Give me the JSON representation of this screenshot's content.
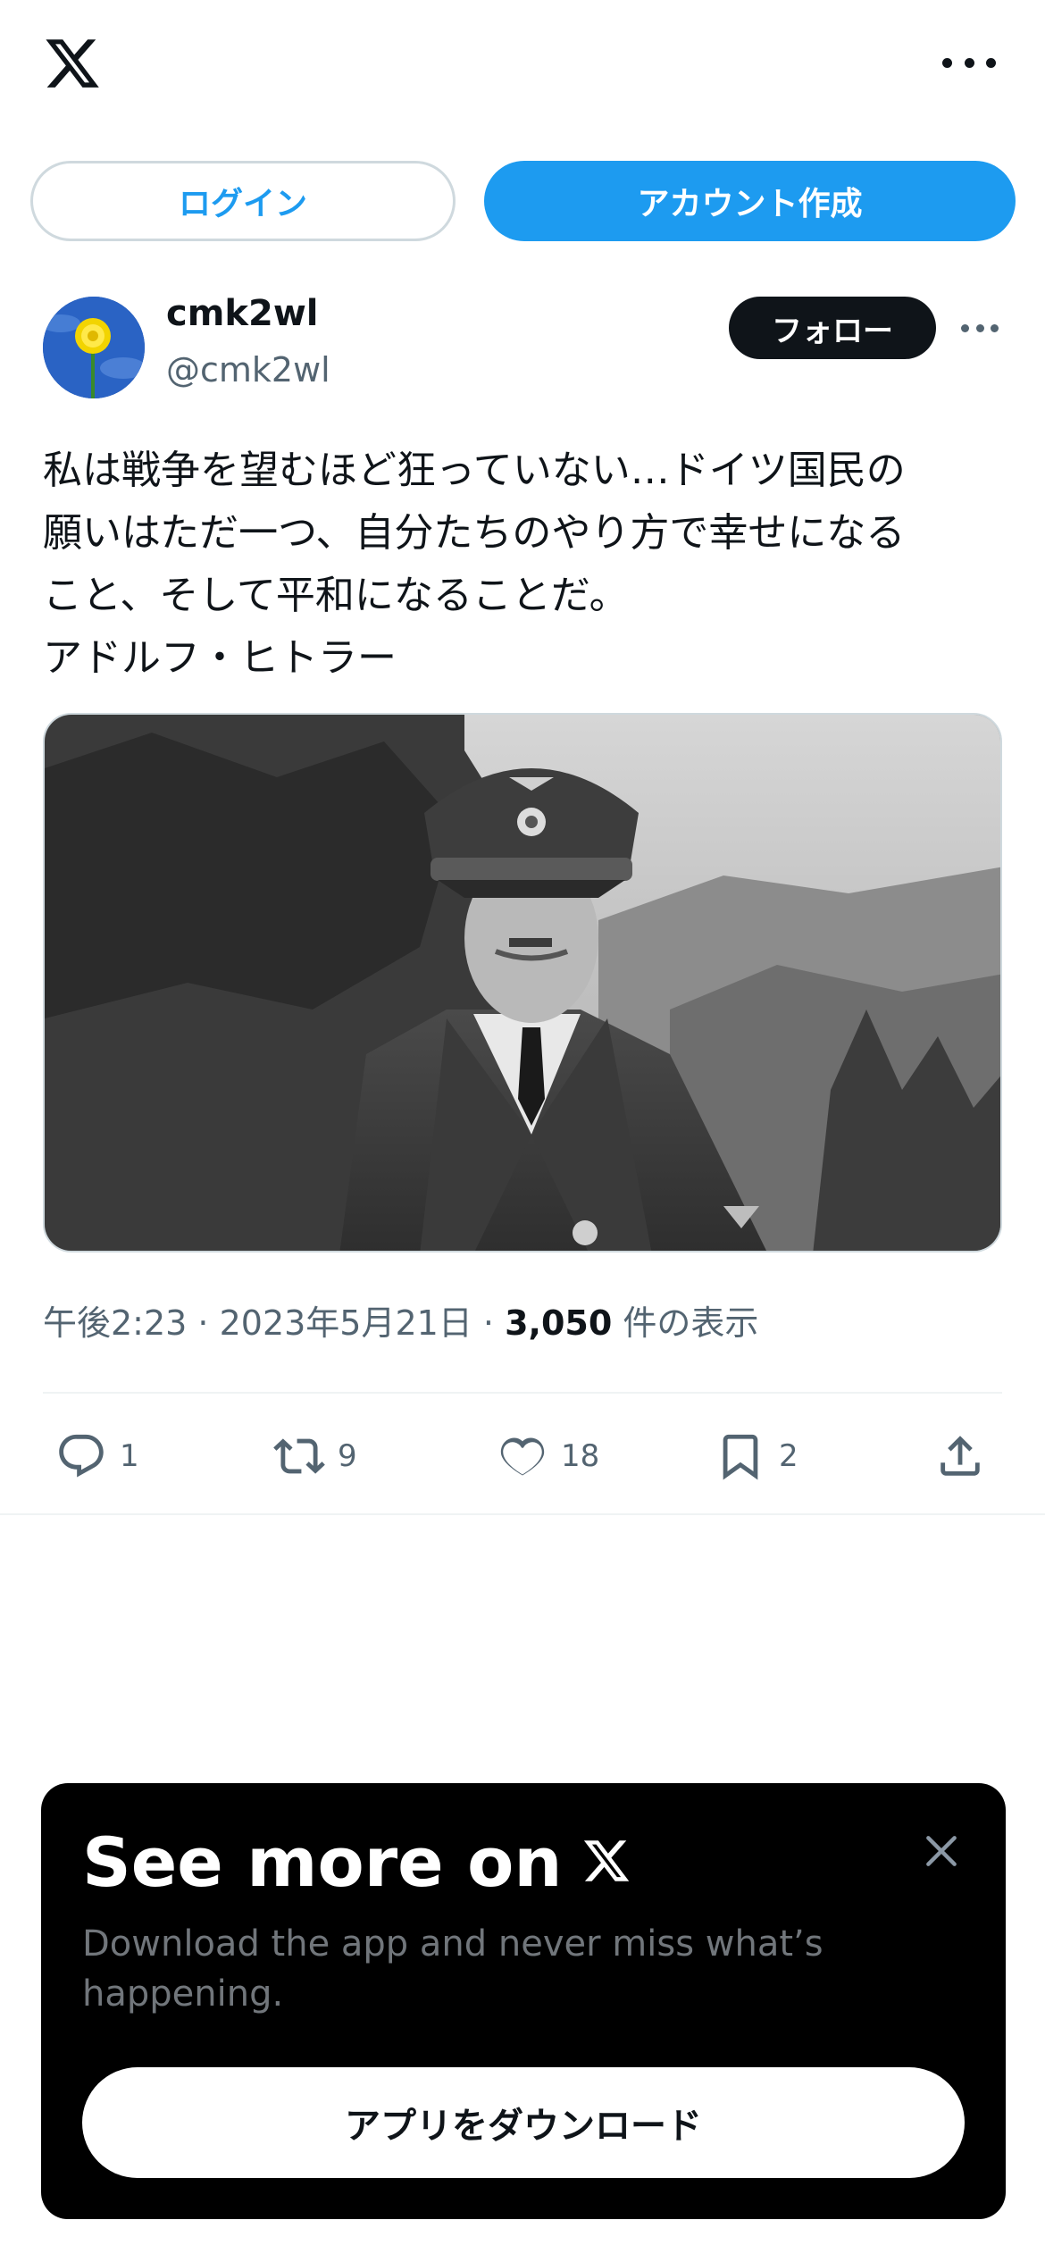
{
  "header": {
    "logo_icon": "x-logo-icon",
    "more_icon": "more-horizontal-icon"
  },
  "auth": {
    "login_label": "ログイン",
    "signup_label": "アカウント作成"
  },
  "tweet": {
    "author": {
      "display_name": "cmk2wl",
      "handle": "@cmk2wl",
      "avatar_icon": "dandelion-avatar"
    },
    "follow_label": "フォロー",
    "text_lines": [
      "私は戦争を望むほど狂っていない…ドイツ国民の",
      "願いはただ一つ、自分たちのやり方で幸せになる",
      "こと、そして平和になることだ。",
      "アドルフ・ヒトラー"
    ],
    "media": {
      "kind": "black-and-white photograph",
      "icon": "photo-image"
    },
    "meta": {
      "time": "午後2:23",
      "separator": " · ",
      "date": "2023年5月21日",
      "views_count": "3,050",
      "views_label": " 件の表示"
    },
    "actions": {
      "reply": {
        "icon": "reply-icon",
        "count": "1"
      },
      "retweet": {
        "icon": "retweet-icon",
        "count": "9"
      },
      "like": {
        "icon": "heart-icon",
        "count": "18"
      },
      "bookmark": {
        "icon": "bookmark-icon",
        "count": "2"
      },
      "share": {
        "icon": "share-icon"
      }
    }
  },
  "promo": {
    "title": "See more on",
    "title_icon": "x-logo-icon",
    "description": "Download the app and never miss what’s happening.",
    "download_label": "アプリをダウンロード",
    "close_icon": "close-icon"
  },
  "colors": {
    "accent": "#1d9bf0",
    "text": "#0f1419",
    "muted": "#536471",
    "border": "#cfd9de",
    "promo_bg": "#000000"
  }
}
